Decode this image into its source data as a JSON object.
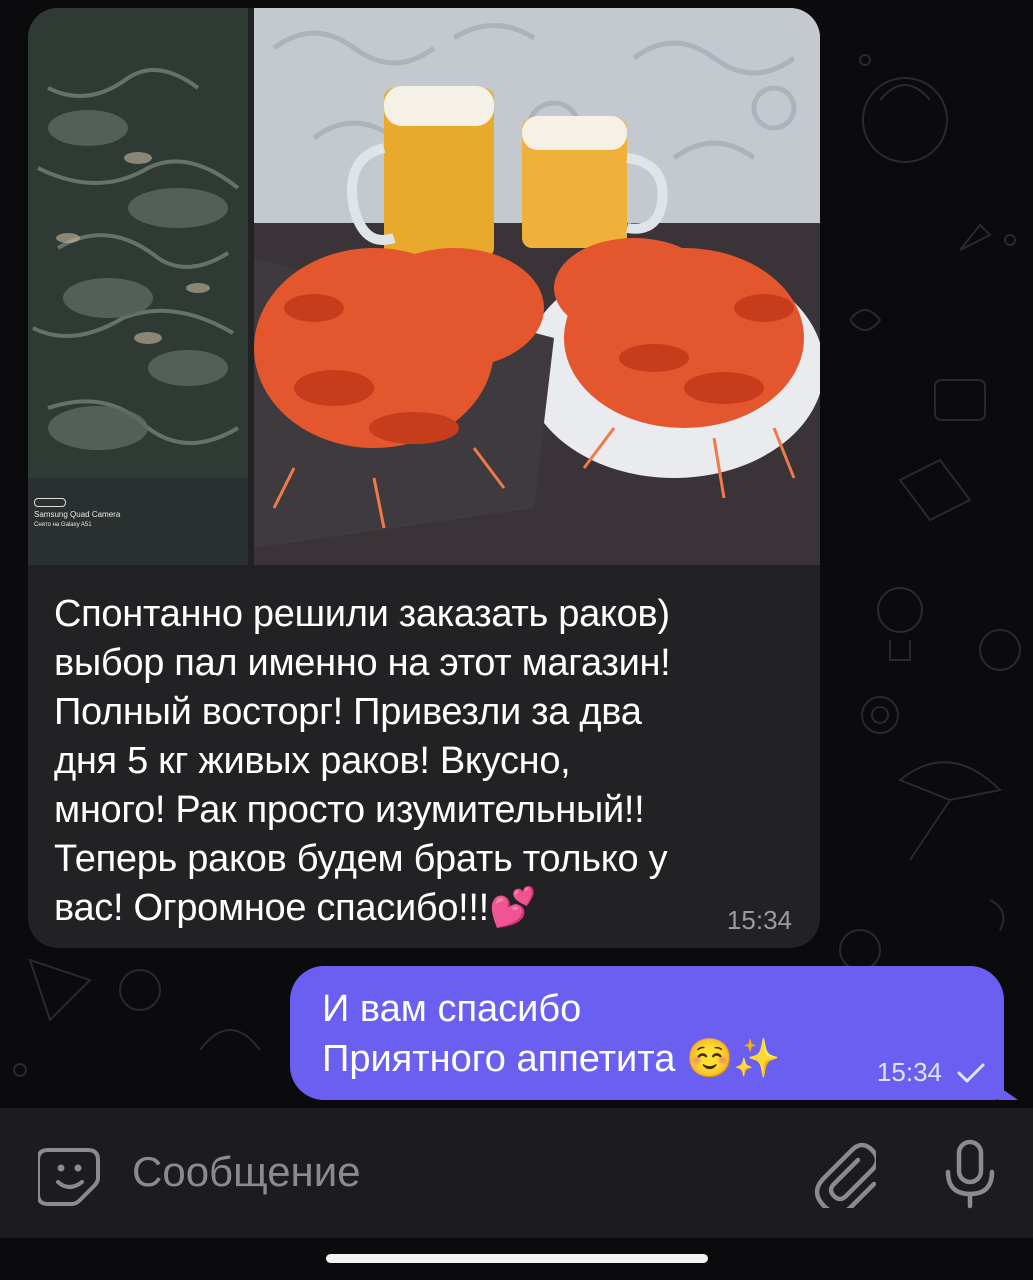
{
  "chat": {
    "incoming": {
      "photo_left_caption_line1": "Samsung Quad Camera",
      "photo_left_caption_line2": "Снято на Galaxy A51",
      "text_lines": [
        "Спонтанно решили заказать раков)",
        "выбор пал именно на этот магазин!",
        "Полный восторг! Привезли за два",
        "дня 5 кг живых раков! Вкусно,",
        "много! Рак просто изумительный!!",
        "Теперь раков будем брать только у",
        "вас! Огромное спасибо!!!💕"
      ],
      "time": "15:34"
    },
    "outgoing": {
      "line1": "И вам спасибо",
      "line2": "Приятного аппетита ☺️✨",
      "time": "15:34",
      "status_icon": "single-check-icon"
    }
  },
  "composer": {
    "placeholder": "Сообщение",
    "emoji_icon": "sticker-smile-icon",
    "attach_icon": "paperclip-icon",
    "mic_icon": "microphone-icon"
  },
  "colors": {
    "background": "#0b0b0d",
    "incoming_bubble": "#222224",
    "outgoing_bubble": "#6a5ff0",
    "composer": "#1c1c1e"
  }
}
